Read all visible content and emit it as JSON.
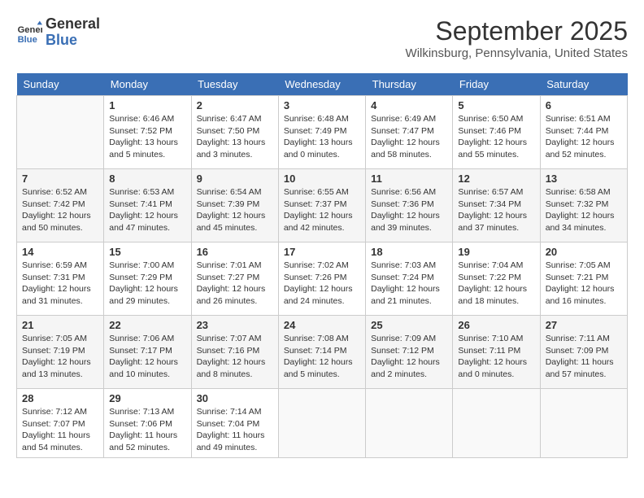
{
  "header": {
    "logo_line1": "General",
    "logo_line2": "Blue",
    "month_year": "September 2025",
    "location": "Wilkinsburg, Pennsylvania, United States"
  },
  "weekdays": [
    "Sunday",
    "Monday",
    "Tuesday",
    "Wednesday",
    "Thursday",
    "Friday",
    "Saturday"
  ],
  "weeks": [
    [
      {
        "day": "",
        "sunrise": "",
        "sunset": "",
        "daylight": ""
      },
      {
        "day": "1",
        "sunrise": "Sunrise: 6:46 AM",
        "sunset": "Sunset: 7:52 PM",
        "daylight": "Daylight: 13 hours and 5 minutes."
      },
      {
        "day": "2",
        "sunrise": "Sunrise: 6:47 AM",
        "sunset": "Sunset: 7:50 PM",
        "daylight": "Daylight: 13 hours and 3 minutes."
      },
      {
        "day": "3",
        "sunrise": "Sunrise: 6:48 AM",
        "sunset": "Sunset: 7:49 PM",
        "daylight": "Daylight: 13 hours and 0 minutes."
      },
      {
        "day": "4",
        "sunrise": "Sunrise: 6:49 AM",
        "sunset": "Sunset: 7:47 PM",
        "daylight": "Daylight: 12 hours and 58 minutes."
      },
      {
        "day": "5",
        "sunrise": "Sunrise: 6:50 AM",
        "sunset": "Sunset: 7:46 PM",
        "daylight": "Daylight: 12 hours and 55 minutes."
      },
      {
        "day": "6",
        "sunrise": "Sunrise: 6:51 AM",
        "sunset": "Sunset: 7:44 PM",
        "daylight": "Daylight: 12 hours and 52 minutes."
      }
    ],
    [
      {
        "day": "7",
        "sunrise": "Sunrise: 6:52 AM",
        "sunset": "Sunset: 7:42 PM",
        "daylight": "Daylight: 12 hours and 50 minutes."
      },
      {
        "day": "8",
        "sunrise": "Sunrise: 6:53 AM",
        "sunset": "Sunset: 7:41 PM",
        "daylight": "Daylight: 12 hours and 47 minutes."
      },
      {
        "day": "9",
        "sunrise": "Sunrise: 6:54 AM",
        "sunset": "Sunset: 7:39 PM",
        "daylight": "Daylight: 12 hours and 45 minutes."
      },
      {
        "day": "10",
        "sunrise": "Sunrise: 6:55 AM",
        "sunset": "Sunset: 7:37 PM",
        "daylight": "Daylight: 12 hours and 42 minutes."
      },
      {
        "day": "11",
        "sunrise": "Sunrise: 6:56 AM",
        "sunset": "Sunset: 7:36 PM",
        "daylight": "Daylight: 12 hours and 39 minutes."
      },
      {
        "day": "12",
        "sunrise": "Sunrise: 6:57 AM",
        "sunset": "Sunset: 7:34 PM",
        "daylight": "Daylight: 12 hours and 37 minutes."
      },
      {
        "day": "13",
        "sunrise": "Sunrise: 6:58 AM",
        "sunset": "Sunset: 7:32 PM",
        "daylight": "Daylight: 12 hours and 34 minutes."
      }
    ],
    [
      {
        "day": "14",
        "sunrise": "Sunrise: 6:59 AM",
        "sunset": "Sunset: 7:31 PM",
        "daylight": "Daylight: 12 hours and 31 minutes."
      },
      {
        "day": "15",
        "sunrise": "Sunrise: 7:00 AM",
        "sunset": "Sunset: 7:29 PM",
        "daylight": "Daylight: 12 hours and 29 minutes."
      },
      {
        "day": "16",
        "sunrise": "Sunrise: 7:01 AM",
        "sunset": "Sunset: 7:27 PM",
        "daylight": "Daylight: 12 hours and 26 minutes."
      },
      {
        "day": "17",
        "sunrise": "Sunrise: 7:02 AM",
        "sunset": "Sunset: 7:26 PM",
        "daylight": "Daylight: 12 hours and 24 minutes."
      },
      {
        "day": "18",
        "sunrise": "Sunrise: 7:03 AM",
        "sunset": "Sunset: 7:24 PM",
        "daylight": "Daylight: 12 hours and 21 minutes."
      },
      {
        "day": "19",
        "sunrise": "Sunrise: 7:04 AM",
        "sunset": "Sunset: 7:22 PM",
        "daylight": "Daylight: 12 hours and 18 minutes."
      },
      {
        "day": "20",
        "sunrise": "Sunrise: 7:05 AM",
        "sunset": "Sunset: 7:21 PM",
        "daylight": "Daylight: 12 hours and 16 minutes."
      }
    ],
    [
      {
        "day": "21",
        "sunrise": "Sunrise: 7:05 AM",
        "sunset": "Sunset: 7:19 PM",
        "daylight": "Daylight: 12 hours and 13 minutes."
      },
      {
        "day": "22",
        "sunrise": "Sunrise: 7:06 AM",
        "sunset": "Sunset: 7:17 PM",
        "daylight": "Daylight: 12 hours and 10 minutes."
      },
      {
        "day": "23",
        "sunrise": "Sunrise: 7:07 AM",
        "sunset": "Sunset: 7:16 PM",
        "daylight": "Daylight: 12 hours and 8 minutes."
      },
      {
        "day": "24",
        "sunrise": "Sunrise: 7:08 AM",
        "sunset": "Sunset: 7:14 PM",
        "daylight": "Daylight: 12 hours and 5 minutes."
      },
      {
        "day": "25",
        "sunrise": "Sunrise: 7:09 AM",
        "sunset": "Sunset: 7:12 PM",
        "daylight": "Daylight: 12 hours and 2 minutes."
      },
      {
        "day": "26",
        "sunrise": "Sunrise: 7:10 AM",
        "sunset": "Sunset: 7:11 PM",
        "daylight": "Daylight: 12 hours and 0 minutes."
      },
      {
        "day": "27",
        "sunrise": "Sunrise: 7:11 AM",
        "sunset": "Sunset: 7:09 PM",
        "daylight": "Daylight: 11 hours and 57 minutes."
      }
    ],
    [
      {
        "day": "28",
        "sunrise": "Sunrise: 7:12 AM",
        "sunset": "Sunset: 7:07 PM",
        "daylight": "Daylight: 11 hours and 54 minutes."
      },
      {
        "day": "29",
        "sunrise": "Sunrise: 7:13 AM",
        "sunset": "Sunset: 7:06 PM",
        "daylight": "Daylight: 11 hours and 52 minutes."
      },
      {
        "day": "30",
        "sunrise": "Sunrise: 7:14 AM",
        "sunset": "Sunset: 7:04 PM",
        "daylight": "Daylight: 11 hours and 49 minutes."
      },
      {
        "day": "",
        "sunrise": "",
        "sunset": "",
        "daylight": ""
      },
      {
        "day": "",
        "sunrise": "",
        "sunset": "",
        "daylight": ""
      },
      {
        "day": "",
        "sunrise": "",
        "sunset": "",
        "daylight": ""
      },
      {
        "day": "",
        "sunrise": "",
        "sunset": "",
        "daylight": ""
      }
    ]
  ]
}
